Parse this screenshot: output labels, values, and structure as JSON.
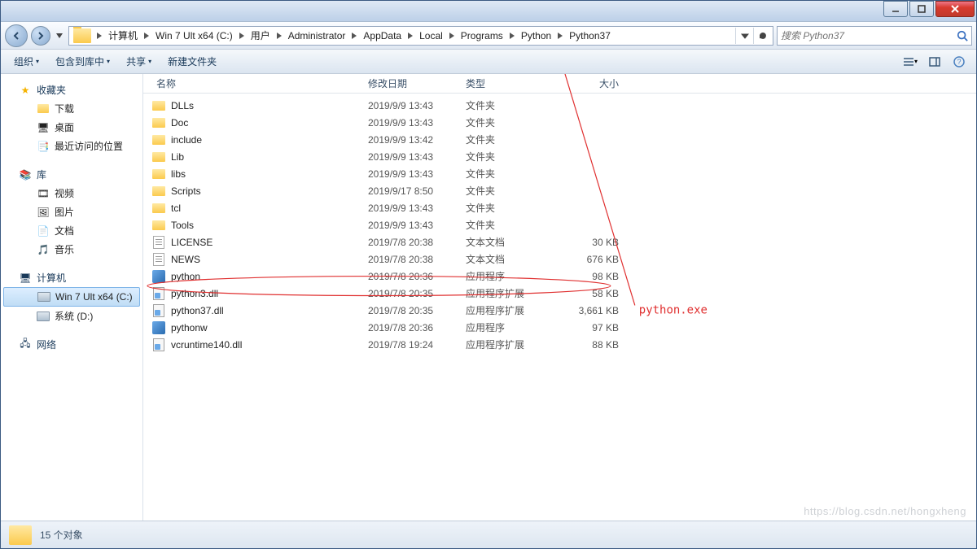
{
  "titlebar": {
    "minimize": "minimize",
    "maximize": "maximize",
    "close": "close"
  },
  "breadcrumbs": [
    "计算机",
    "Win 7 Ult x64 (C:)",
    "用户",
    "Administrator",
    "AppData",
    "Local",
    "Programs",
    "Python",
    "Python37"
  ],
  "search": {
    "placeholder": "搜索 Python37"
  },
  "toolbar": {
    "organize": "组织",
    "include": "包含到库中",
    "share": "共享",
    "newfolder": "新建文件夹"
  },
  "sidebar": {
    "favorites": {
      "label": "收藏夹",
      "items": [
        "下载",
        "桌面",
        "最近访问的位置"
      ]
    },
    "libraries": {
      "label": "库",
      "items": [
        "视频",
        "图片",
        "文档",
        "音乐"
      ]
    },
    "computer": {
      "label": "计算机",
      "items": [
        "Win 7 Ult x64 (C:)",
        "系统 (D:)"
      ]
    },
    "network": {
      "label": "网络"
    }
  },
  "columns": {
    "name": "名称",
    "date": "修改日期",
    "type": "类型",
    "size": "大小"
  },
  "files": [
    {
      "icon": "folder",
      "name": "DLLs",
      "date": "2019/9/9 13:43",
      "type": "文件夹",
      "size": ""
    },
    {
      "icon": "folder",
      "name": "Doc",
      "date": "2019/9/9 13:43",
      "type": "文件夹",
      "size": ""
    },
    {
      "icon": "folder",
      "name": "include",
      "date": "2019/9/9 13:42",
      "type": "文件夹",
      "size": ""
    },
    {
      "icon": "folder",
      "name": "Lib",
      "date": "2019/9/9 13:43",
      "type": "文件夹",
      "size": ""
    },
    {
      "icon": "folder",
      "name": "libs",
      "date": "2019/9/9 13:43",
      "type": "文件夹",
      "size": ""
    },
    {
      "icon": "folder",
      "name": "Scripts",
      "date": "2019/9/17 8:50",
      "type": "文件夹",
      "size": ""
    },
    {
      "icon": "folder",
      "name": "tcl",
      "date": "2019/9/9 13:43",
      "type": "文件夹",
      "size": ""
    },
    {
      "icon": "folder",
      "name": "Tools",
      "date": "2019/9/9 13:43",
      "type": "文件夹",
      "size": ""
    },
    {
      "icon": "txt",
      "name": "LICENSE",
      "date": "2019/7/8 20:38",
      "type": "文本文档",
      "size": "30 KB"
    },
    {
      "icon": "txt",
      "name": "NEWS",
      "date": "2019/7/8 20:38",
      "type": "文本文档",
      "size": "676 KB"
    },
    {
      "icon": "exe",
      "name": "python",
      "date": "2019/7/8 20:36",
      "type": "应用程序",
      "size": "98 KB"
    },
    {
      "icon": "dll",
      "name": "python3.dll",
      "date": "2019/7/8 20:35",
      "type": "应用程序扩展",
      "size": "58 KB"
    },
    {
      "icon": "dll",
      "name": "python37.dll",
      "date": "2019/7/8 20:35",
      "type": "应用程序扩展",
      "size": "3,661 KB"
    },
    {
      "icon": "exe",
      "name": "pythonw",
      "date": "2019/7/8 20:36",
      "type": "应用程序",
      "size": "97 KB"
    },
    {
      "icon": "dll",
      "name": "vcruntime140.dll",
      "date": "2019/7/8 19:24",
      "type": "应用程序扩展",
      "size": "88 KB"
    }
  ],
  "statusbar": {
    "count": "15 个对象"
  },
  "annotation": {
    "label": "python.exe"
  },
  "watermark": "https://blog.csdn.net/hongxheng"
}
